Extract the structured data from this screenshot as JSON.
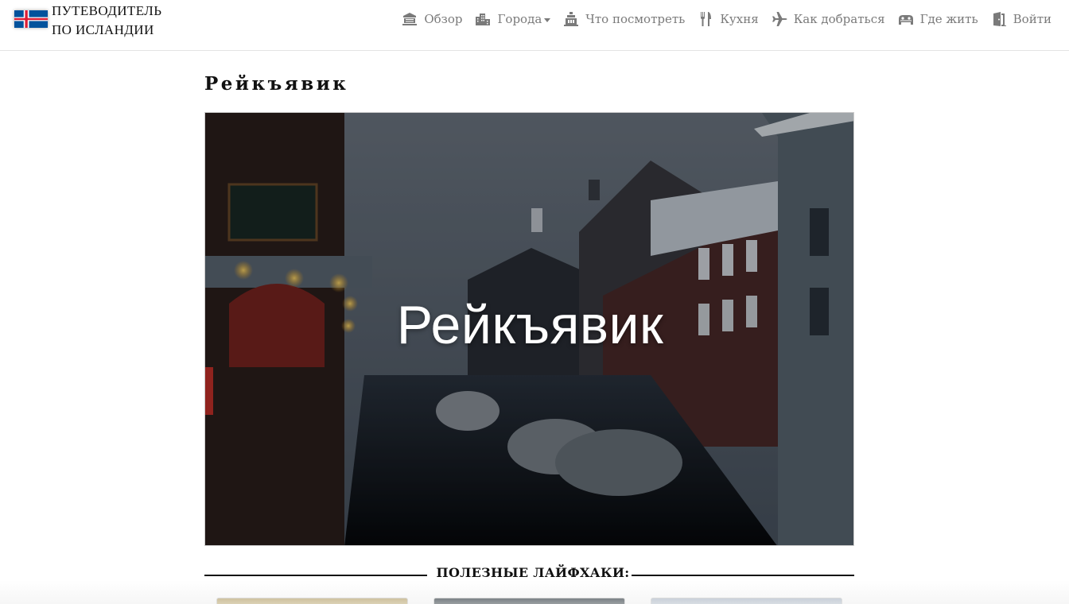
{
  "brand": {
    "line1": "ПУТЕВОДИТЕЛЬ",
    "line2": "ПО ИСЛАНДИИ",
    "flag_colors": {
      "field": "#02529C",
      "cross_white": "#FFFFFF",
      "cross_red": "#DC1E35"
    }
  },
  "nav": {
    "items": [
      {
        "label": "Обзор",
        "icon": "landmark-icon"
      },
      {
        "label": "Города",
        "icon": "city-icon",
        "dropdown": true
      },
      {
        "label": "Что посмотреть",
        "icon": "monument-icon"
      },
      {
        "label": "Кухня",
        "icon": "utensils-icon"
      },
      {
        "label": "Как добраться",
        "icon": "plane-icon"
      },
      {
        "label": "Где жить",
        "icon": "hotel-icon"
      },
      {
        "label": "Войти",
        "icon": "door-icon"
      }
    ],
    "text_color": "#7A7A7A"
  },
  "page": {
    "title": "Рейкъявик",
    "hero_caption": "Рейкъявик"
  },
  "section": {
    "title": "ПОЛЕЗНЫЕ ЛАЙФХАКИ:",
    "icon": "paperclip-icon"
  },
  "cards": [
    {
      "name": "lifehack-card-1"
    },
    {
      "name": "lifehack-card-2"
    },
    {
      "name": "lifehack-card-3"
    }
  ]
}
